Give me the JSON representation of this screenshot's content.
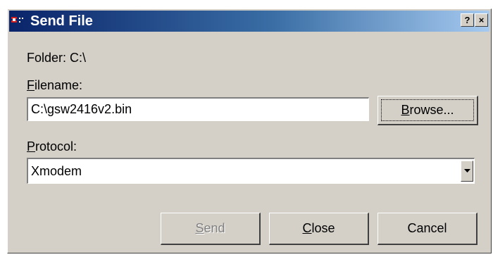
{
  "window": {
    "title": "Send File",
    "help_glyph": "?",
    "close_glyph": "×"
  },
  "folder": {
    "label": "Folder:",
    "value": "C:\\"
  },
  "filename": {
    "label_accel": "F",
    "label_rest": "ilename:",
    "value": "C:\\gsw2416v2.bin"
  },
  "browse": {
    "accel": "B",
    "rest": "rowse..."
  },
  "protocol": {
    "label_accel": "P",
    "label_rest": "rotocol:",
    "selected": "Xmodem"
  },
  "buttons": {
    "send": {
      "accel": "S",
      "rest": "end",
      "enabled": false
    },
    "close": {
      "accel": "C",
      "rest": "lose"
    },
    "cancel": {
      "label": "Cancel"
    }
  },
  "icons": {
    "app": "terminal-app-icon",
    "help": "help-icon",
    "close": "close-icon",
    "dropdown": "chevron-down-icon"
  }
}
